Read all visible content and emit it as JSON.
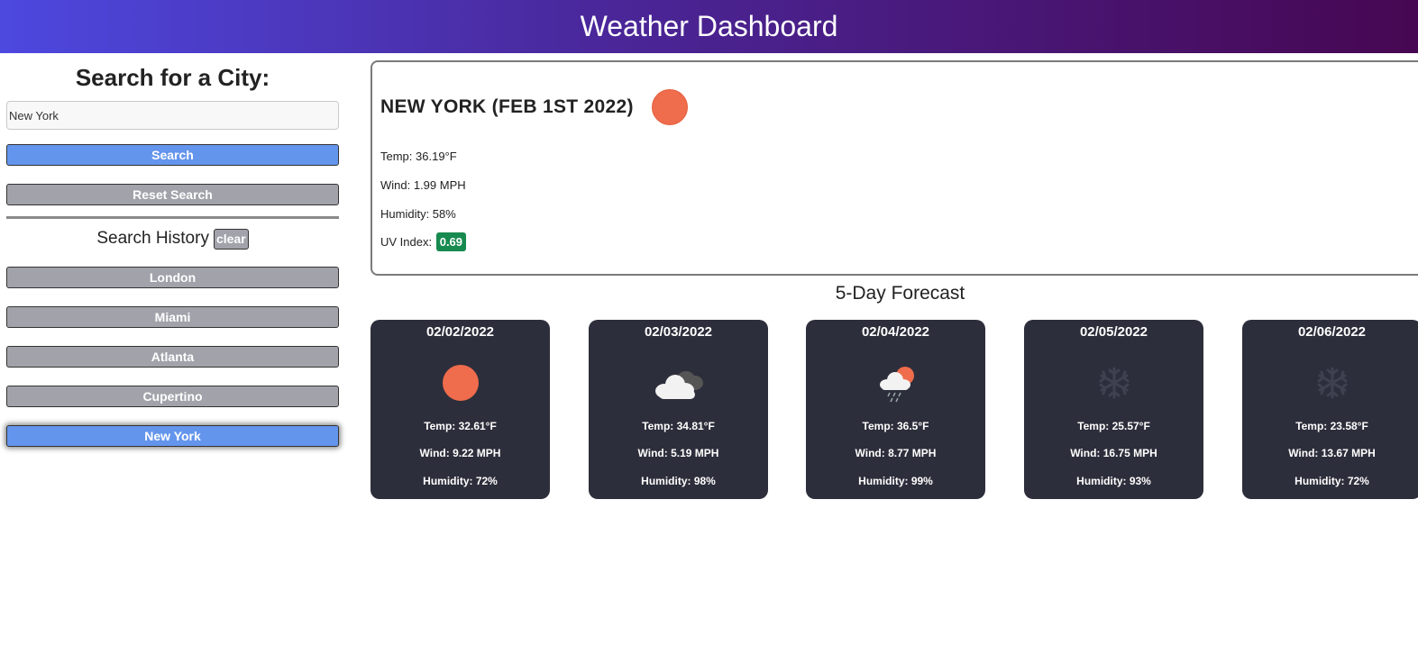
{
  "header": {
    "title": "Weather Dashboard"
  },
  "sidebar": {
    "search_title": "Search for a City:",
    "search_value": "New York",
    "search_button": "Search",
    "reset_button": "Reset Search",
    "history_title": "Search History",
    "clear_button": "clear",
    "history": [
      "London",
      "Miami",
      "Atlanta",
      "Cupertino",
      "New York"
    ]
  },
  "current": {
    "title": "NEW YORK (FEB 1ST 2022)",
    "icon": "sun-icon",
    "temp": "Temp: 36.19°F",
    "wind": "Wind: 1.99 MPH",
    "humidity": "Humidity: 58%",
    "uv_label": "UV Index:",
    "uv_value": "0.69"
  },
  "forecast": {
    "title": "5-Day Forecast",
    "days": [
      {
        "date": "02/02/2022",
        "icon": "sun-icon",
        "temp": "Temp: 32.61°F",
        "wind": "Wind: 9.22 MPH",
        "humidity": "Humidity: 72%"
      },
      {
        "date": "02/03/2022",
        "icon": "cloud-icon",
        "temp": "Temp: 34.81°F",
        "wind": "Wind: 5.19 MPH",
        "humidity": "Humidity: 98%"
      },
      {
        "date": "02/04/2022",
        "icon": "rain-sun-icon",
        "temp": "Temp: 36.5°F",
        "wind": "Wind: 8.77 MPH",
        "humidity": "Humidity: 99%"
      },
      {
        "date": "02/05/2022",
        "icon": "snow-icon",
        "temp": "Temp: 25.57°F",
        "wind": "Wind: 16.75 MPH",
        "humidity": "Humidity: 93%"
      },
      {
        "date": "02/06/2022",
        "icon": "snow-icon",
        "temp": "Temp: 23.58°F",
        "wind": "Wind: 13.67 MPH",
        "humidity": "Humidity: 72%"
      }
    ]
  },
  "colors": {
    "accent_blue": "#6495ed",
    "button_gray": "#a2a2ab",
    "card_bg": "#2d2e3b",
    "sun": "#ef6c4c",
    "uv_green": "#178a4f"
  }
}
